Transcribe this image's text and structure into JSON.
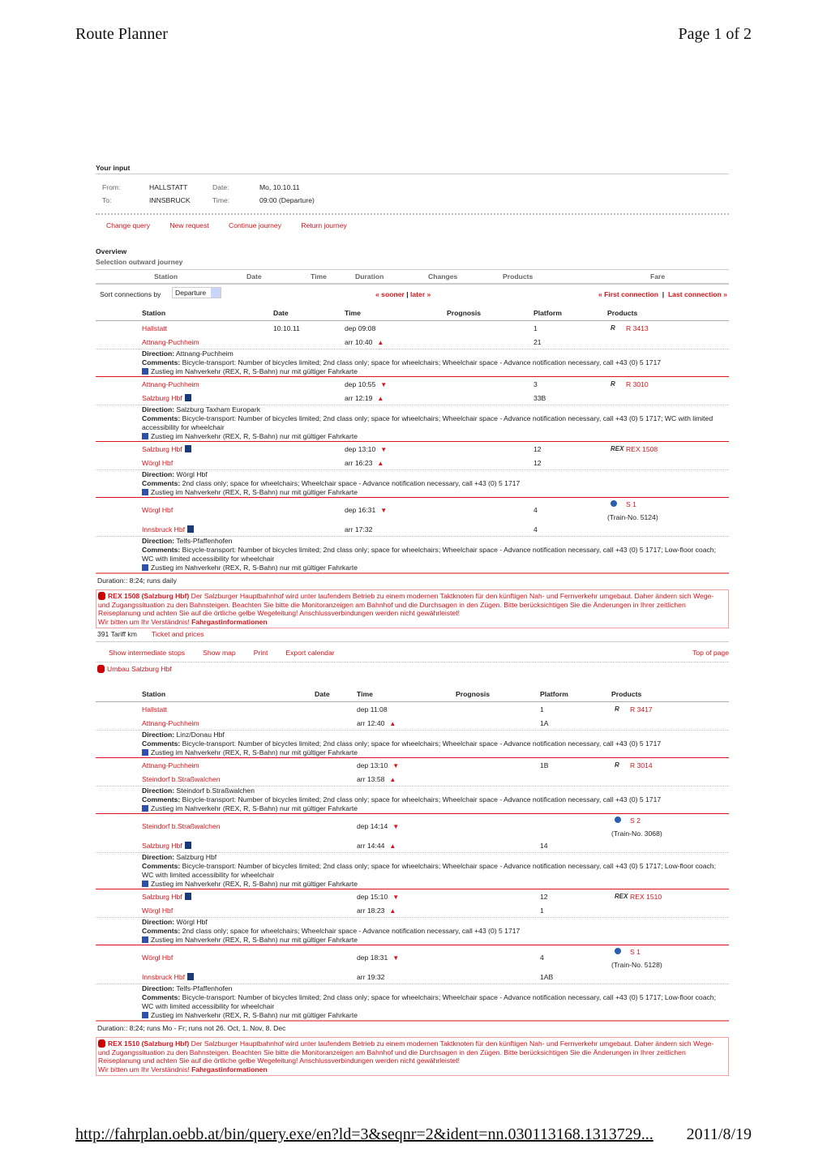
{
  "header": {
    "title": "Route Planner",
    "page": "Page 1 of 2"
  },
  "footer": {
    "url": "http://fahrplan.oebb.at/bin/query.exe/en?ld=3&seqnr=2&ident=nn.030113168.1313729...",
    "date": "2011/8/19"
  },
  "input": {
    "heading": "Your input",
    "from_label": "From:",
    "from": "HALLSTATT",
    "to_label": "To:",
    "to": "INNSBRUCK",
    "date_label": "Date:",
    "date": "Mo, 10.10.11",
    "time_label": "Time:",
    "time": "09:00 (Departure)"
  },
  "actions": [
    "Change query",
    "New request",
    "Continue journey",
    "Return journey"
  ],
  "overview": {
    "heading": "Overview",
    "subheading": "Selection outward journey",
    "columns": [
      "Station",
      "Date",
      "Time",
      "Duration",
      "Changes",
      "Products",
      "Fare"
    ],
    "sort_label": "Sort connections by",
    "sort_value": "Departure",
    "sooner": "« sooner",
    "later": "later »",
    "first": "« First connection",
    "last": "Last connection »",
    "sep": "|"
  },
  "table_columns": [
    "Station",
    "Date",
    "Time",
    "Prognosis",
    "Platform",
    "Products"
  ],
  "connections": [
    {
      "legs": [
        {
          "dep": {
            "station": "Hallstatt",
            "date": "10.10.11",
            "time": "dep 09:08",
            "platform": "1"
          },
          "arr": {
            "station": "Attnang-Puchheim",
            "time": "arr 10:40",
            "platform": "21"
          },
          "dep_tri": "",
          "arr_tri": "▲",
          "product_icon": "R",
          "product": "R 3413",
          "direction": "Attnang-Puchheim",
          "comments": "Bicycle-transport: Number of bicycles limited; 2nd class only; space for wheelchairs; Wheelchair space - Advance notification necessary, call +43 (0) 5 1717"
        },
        {
          "dep": {
            "station": "Attnang-Puchheim",
            "time": "dep 10:55",
            "platform": "3"
          },
          "arr": {
            "station": "Salzburg Hbf",
            "station_icon": true,
            "time": "arr 12:19",
            "platform": "33B"
          },
          "dep_tri": "▼",
          "arr_tri": "▲",
          "product_icon": "R",
          "product": "R 3010",
          "direction": "Salzburg Taxham Europark",
          "comments": "Bicycle-transport: Number of bicycles limited; 2nd class only; space for wheelchairs; Wheelchair space - Advance notification necessary, call +43 (0) 5 1717; WC with limited accessibility for wheelchair"
        },
        {
          "dep": {
            "station": "Salzburg Hbf",
            "station_icon": true,
            "time": "dep 13:10",
            "platform": "12"
          },
          "arr": {
            "station": "Wörgl Hbf",
            "time": "arr 16:23",
            "platform": "12"
          },
          "dep_tri": "▼",
          "arr_tri": "▲",
          "product_icon": "REX",
          "product": "REX 1508",
          "direction": "Wörgl Hbf",
          "comments": "2nd class only; space for wheelchairs; Wheelchair space - Advance notification necessary, call +43 (0) 5 1717"
        },
        {
          "dep": {
            "station": "Wörgl Hbf",
            "time": "dep 16:31",
            "platform": "4"
          },
          "arr": {
            "station": "Innsbruck Hbf",
            "station_icon": true,
            "time": "arr 17:32",
            "platform": "4"
          },
          "dep_tri": "▼",
          "arr_tri": "",
          "product_icon": "S",
          "product": "S 1",
          "train_no": "(Train-No. 5124)",
          "direction": "Telfs-Pfaffenhofen",
          "comments": "Bicycle-transport: Number of bicycles limited; 2nd class only; space for wheelchairs; Wheelchair space - Advance notification necessary, call +43 (0) 5 1717; Low-floor coach; WC with limited accessibility for wheelchair"
        }
      ],
      "duration": "Duration:: 8:24; runs daily",
      "notice": {
        "title": "REX 1508  (Salzburg Hbf)",
        "text": "Der Salzburger Hauptbahnhof wird unter laufendem Betrieb zu einem modernen Taktknoten für den künftigen Nah- und Fernverkehr umgebaut. Daher ändern sich Wege- und Zugangssituation zu den Bahnsteigen. Beachten Sie bitte die Monitoranzeigen am Bahnhof und die Durchsagen in den Zügen. Bitte berücksichtigen Sie die Änderungen in Ihrer zeitlichen Reiseplanung und achten Sie auf die örtliche gelbe Wegeleitung! Anschlussverbindungen werden nicht gewährleistet!",
        "tail": "Wir bitten um Ihr Verständnis!",
        "link": "Fahrgastinformationen"
      },
      "tariff": "391 Tariff km",
      "ticket": "Ticket and prices",
      "links": [
        "Show intermediate stops",
        "Show map",
        "Print",
        "Export calendar"
      ],
      "top": "Top of page",
      "umbau": "Umbau Salzburg Hbf"
    },
    {
      "legs": [
        {
          "dep": {
            "station": "Hallstatt",
            "time": "dep 11:08",
            "platform": "1"
          },
          "arr": {
            "station": "Attnang-Puchheim",
            "time": "arr 12:40",
            "platform": "1A"
          },
          "dep_tri": "",
          "arr_tri": "▲",
          "product_icon": "R",
          "product": "R 3417",
          "direction": "Linz/Donau Hbf",
          "comments": "Bicycle-transport: Number of bicycles limited; 2nd class only; space for wheelchairs; Wheelchair space - Advance notification necessary, call +43 (0) 5 1717"
        },
        {
          "dep": {
            "station": "Attnang-Puchheim",
            "time": "dep 13:10",
            "platform": "1B"
          },
          "arr": {
            "station": "Steindorf b.Straßwalchen",
            "time": "arr 13:58",
            "platform": ""
          },
          "dep_tri": "▼",
          "arr_tri": "▲",
          "product_icon": "R",
          "product": "R 3014",
          "direction": "Steindorf b.Straßwalchen",
          "comments": "Bicycle-transport: Number of bicycles limited; 2nd class only; space for wheelchairs; Wheelchair space - Advance notification necessary, call +43 (0) 5 1717"
        },
        {
          "dep": {
            "station": "Steindorf b.Straßwalchen",
            "time": "dep 14:14",
            "platform": ""
          },
          "arr": {
            "station": "Salzburg Hbf",
            "station_icon": true,
            "time": "arr 14:44",
            "platform": "14"
          },
          "dep_tri": "▼",
          "arr_tri": "▲",
          "product_icon": "S",
          "product": "S 2",
          "train_no": "(Train-No. 3068)",
          "direction": "Salzburg Hbf",
          "comments": "Bicycle-transport: Number of bicycles limited; 2nd class only; space for wheelchairs; Wheelchair space - Advance notification necessary, call +43 (0) 5 1717; Low-floor coach; WC with limited accessibility for wheelchair"
        },
        {
          "dep": {
            "station": "Salzburg Hbf",
            "station_icon": true,
            "time": "dep 15:10",
            "platform": "12"
          },
          "arr": {
            "station": "Wörgl Hbf",
            "time": "arr 18:23",
            "platform": "1"
          },
          "dep_tri": "▼",
          "arr_tri": "▲",
          "product_icon": "REX",
          "product": "REX 1510",
          "direction": "Wörgl Hbf",
          "comments": "2nd class only; space for wheelchairs; Wheelchair space - Advance notification necessary, call +43 (0) 5 1717"
        },
        {
          "dep": {
            "station": "Wörgl Hbf",
            "time": "dep 18:31",
            "platform": "4"
          },
          "arr": {
            "station": "Innsbruck Hbf",
            "station_icon": true,
            "time": "arr 19:32",
            "platform": "1AB"
          },
          "dep_tri": "▼",
          "arr_tri": "",
          "product_icon": "S",
          "product": "S 1",
          "train_no": "(Train-No. 5128)",
          "direction": "Telfs-Pfaffenhofen",
          "comments": "Bicycle-transport: Number of bicycles limited; 2nd class only; space for wheelchairs; Wheelchair space - Advance notification necessary, call +43 (0) 5 1717; Low-floor coach; WC with limited accessibility for wheelchair"
        }
      ],
      "duration": "Duration:: 8:24; runs Mo - Fr; runs not 26. Oct, 1. Nov, 8. Dec",
      "notice": {
        "title": "REX 1510  (Salzburg Hbf)",
        "text": "Der Salzburger Hauptbahnhof wird unter laufendem Betrieb zu einem modernen Taktknoten für den künftigen Nah- und Fernverkehr umgebaut. Daher ändern sich Wege- und Zugangssituation zu den Bahnsteigen. Beachten Sie bitte die Monitoranzeigen am Bahnhof und die Durchsagen in den Zügen. Bitte berücksichtigen Sie die Änderungen in Ihrer zeitlichen Reiseplanung und achten Sie auf die örtliche gelbe Wegeleitung! Anschlussverbindungen werden nicht gewährleistet!",
        "tail": "Wir bitten um Ihr Verständnis!",
        "link": "Fahrgastinformationen"
      }
    }
  ],
  "labels": {
    "direction": "Direction:",
    "comments": "Comments:",
    "zustieg": "Zustieg im Nahverkehr (REX, R, S-Bahn) nur mit gültiger Fahrkarte"
  },
  "colors": {
    "accent": "#d9141b"
  }
}
